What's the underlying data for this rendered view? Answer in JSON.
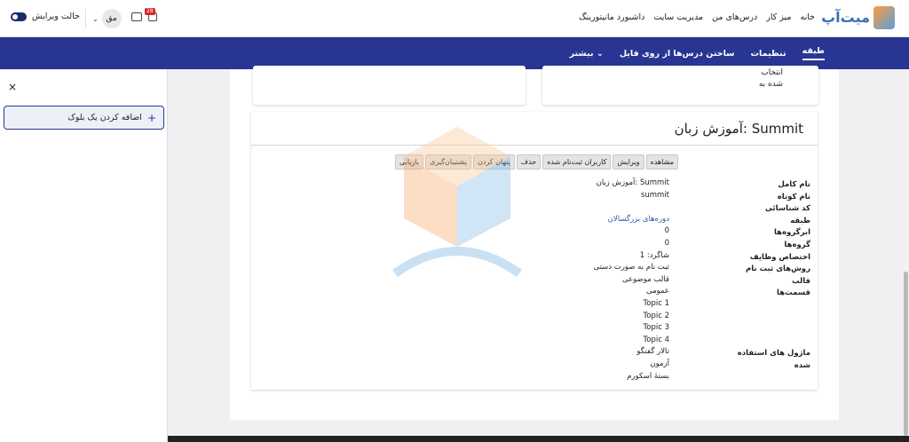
{
  "brand": {
    "logo_text": "میت‌آپ"
  },
  "topnav": [
    "خانه",
    "میز کار",
    "درس‌های من",
    "مدیریت سایت",
    "داشبورد مانیتورینگ"
  ],
  "header": {
    "edit_mode": "حالت ویرایش",
    "user_initials": "مق",
    "notification_count": "28"
  },
  "secnav": [
    "طبقه",
    "تنظیمات",
    "ساختن درس‌ها از روی فایل",
    "بیشتر ⌄"
  ],
  "drawer": {
    "close": "×",
    "add_block": "اضافه کردن یک بلوک",
    "plus": "+"
  },
  "prev_card": {
    "line1": "انتخاب",
    "line2": "شده به"
  },
  "course": {
    "title": "آموزش زبان: Summit",
    "actions": [
      "مشاهده",
      "ویرایش",
      "کاربران ثبت‌نام شده",
      "حذف",
      "پنهان کردن",
      "پشتیبان‌گیری",
      "بازیابی"
    ],
    "labels": [
      "نام کامل",
      "نام کوتاه",
      "کد شناسائی",
      "طبقه",
      "ابرگروه‌ها",
      "گروه‌ها",
      "اختصاص وظایف",
      "روش‌های ثبت نام",
      "قالب",
      "قسمت‌ها",
      "",
      "",
      "",
      "",
      "ماژول های استفاده شده"
    ],
    "values": [
      "آموزش زبان: Summit",
      "summit",
      "",
      "دوره‌های بزرگسالان",
      "0",
      "0",
      "شاگرد: 1",
      "ثبت نام به صورت دستی",
      "قالب موضوعی",
      "عمومی",
      "Topic 1",
      "Topic 2",
      "Topic 3",
      "Topic 4",
      "تالار گفتگو",
      "آزمون",
      "بستهٔ اسکورم"
    ]
  },
  "colors": {
    "primary": "#283593",
    "link": "#2f55a4",
    "badge": "#d9262c"
  }
}
